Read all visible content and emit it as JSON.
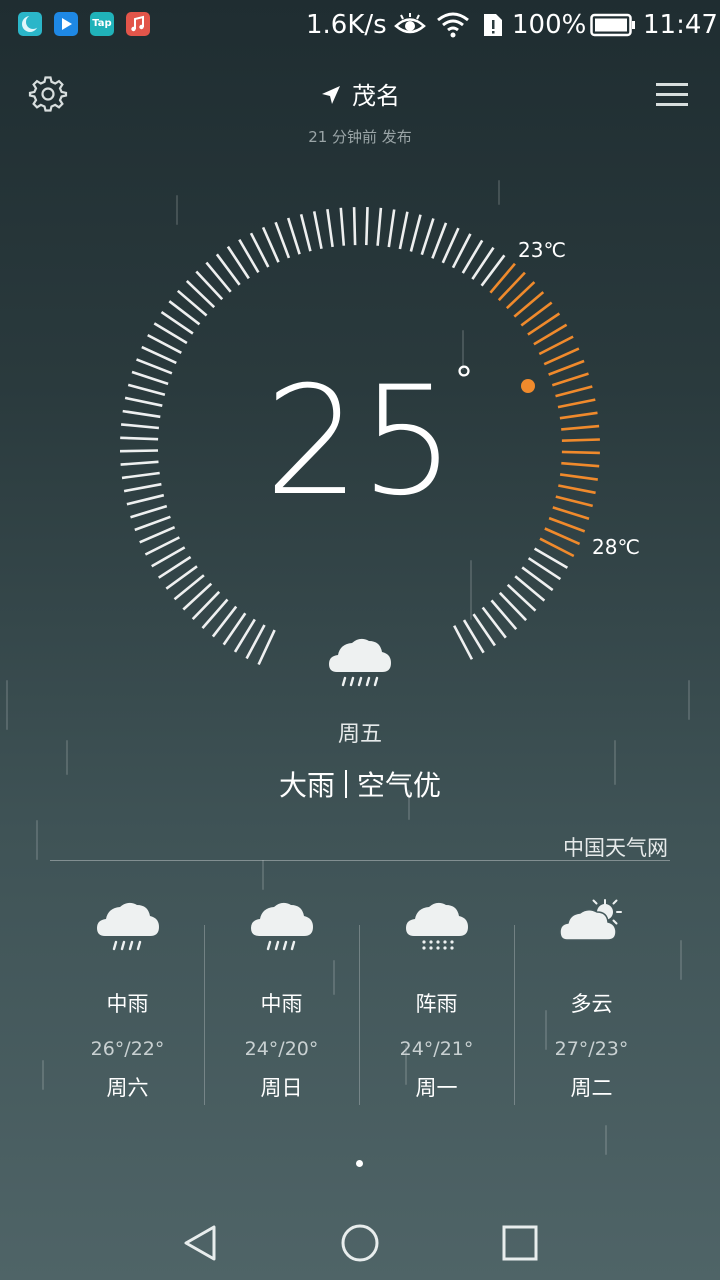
{
  "status_bar": {
    "apps": [
      "moon-app-icon",
      "play-store-icon",
      "tap-app-icon",
      "music-app-icon"
    ],
    "tap_label": "Tap",
    "speed": "1.6K/s",
    "battery": "100%",
    "time": "11:47"
  },
  "header": {
    "city": "茂名",
    "updated": "21 分钟前 发布"
  },
  "dial": {
    "current_temp": "25",
    "degree_symbol": "°",
    "low_label": "23℃",
    "high_label": "28℃"
  },
  "today": {
    "day": "周五",
    "weather": "大雨",
    "air": "空气优",
    "icon": "heavy-rain-cloud-icon"
  },
  "source": "中国天气网",
  "forecast": [
    {
      "condition": "中雨",
      "temp": "26°/22°",
      "day": "周六",
      "icon": "rain-cloud-icon"
    },
    {
      "condition": "中雨",
      "temp": "24°/20°",
      "day": "周日",
      "icon": "rain-cloud-icon"
    },
    {
      "condition": "阵雨",
      "temp": "24°/21°",
      "day": "周一",
      "icon": "shower-cloud-icon"
    },
    {
      "condition": "多云",
      "temp": "27°/23°",
      "day": "周二",
      "icon": "partly-cloudy-icon"
    }
  ],
  "colors": {
    "accent_orange": "#f08a2c",
    "tick_white": "#ffffff"
  },
  "navbar": [
    "back-icon",
    "home-icon",
    "recents-icon"
  ]
}
